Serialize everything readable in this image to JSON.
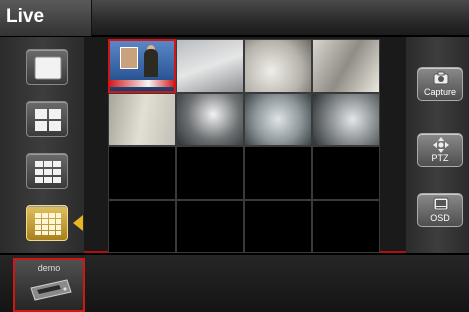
{
  "app": {
    "title": "Live"
  },
  "layouts": [
    {
      "name": "single-view",
      "grid": 1,
      "active": false
    },
    {
      "name": "quad-view",
      "grid": 2,
      "active": false
    },
    {
      "name": "nine-view",
      "grid": 3,
      "active": false
    },
    {
      "name": "sixteen-view",
      "grid": 4,
      "active": true
    }
  ],
  "side_buttons": {
    "capture": {
      "label": "Capture",
      "icon": "camera-icon"
    },
    "ptz": {
      "label": "PTZ",
      "icon": "ptz-arrows-icon"
    },
    "osd": {
      "label": "OSD",
      "icon": "osd-screen-icon"
    }
  },
  "grid": {
    "rows": 4,
    "cols": 4,
    "selected_cell": 0,
    "channels": [
      "news",
      "feed-a",
      "feed-c",
      "feed-d",
      "feed-e",
      "feed-f",
      "feed-g",
      "feed-h",
      "empty",
      "empty",
      "empty",
      "empty",
      "empty",
      "empty",
      "empty",
      "empty"
    ]
  },
  "devices": [
    {
      "name": "demo",
      "icon": "dvr-device-icon",
      "selected": true
    }
  ],
  "colors": {
    "accent_red": "#d21515",
    "active_gold": "#e0c060"
  }
}
